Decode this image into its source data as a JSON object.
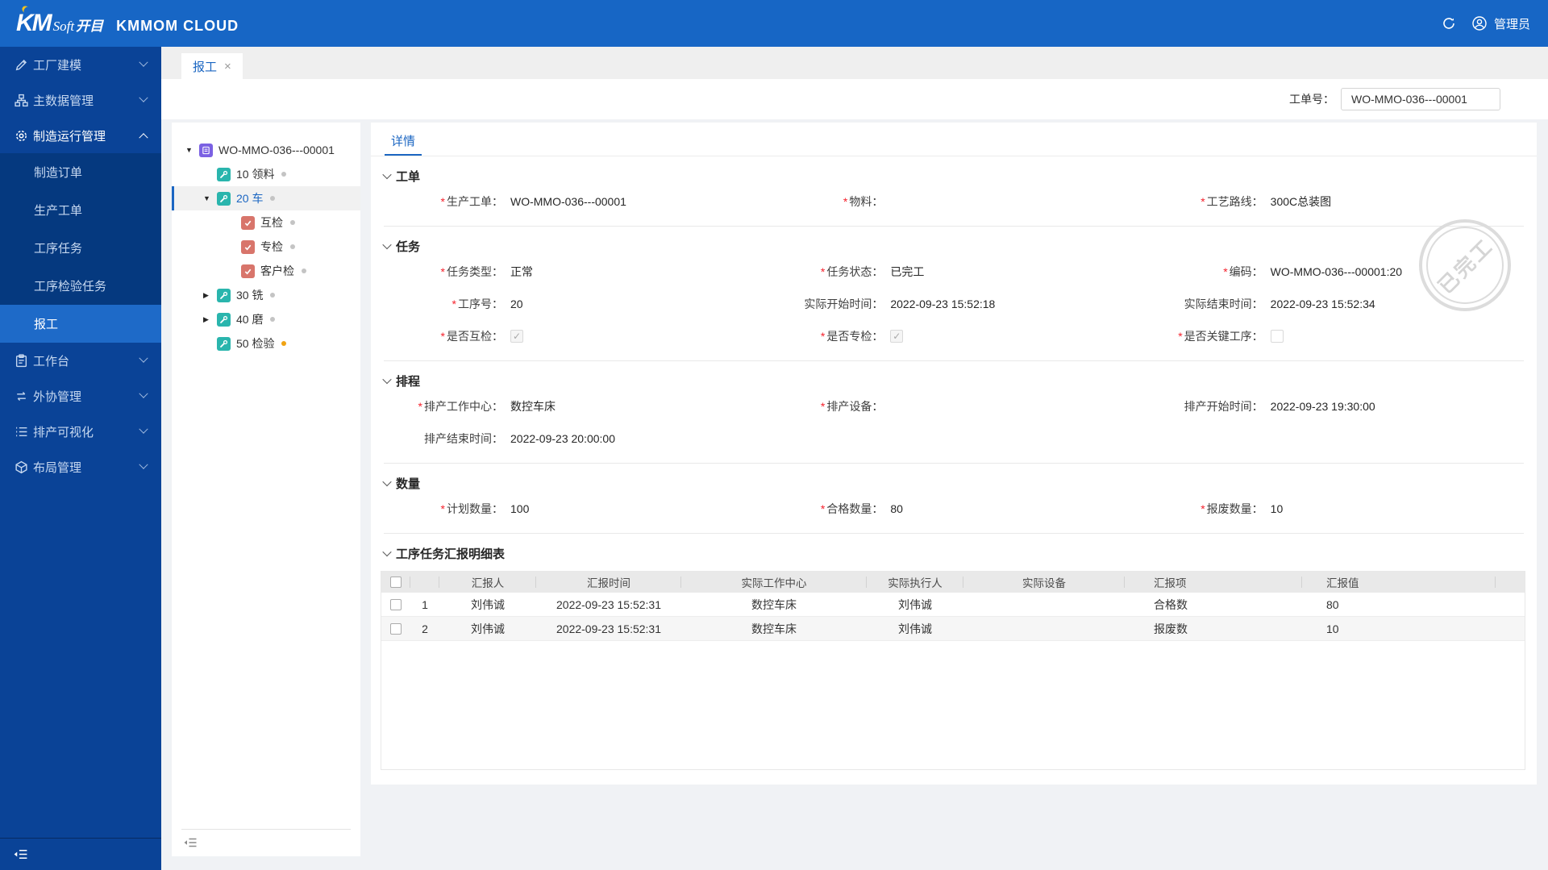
{
  "icons": {
    "asterisk": "*",
    "close": "×",
    "check": "✓",
    "tri_down": "▼",
    "tri_right": "▶"
  },
  "topbar": {
    "logo_km": "KM",
    "logo_soft": "Soft",
    "logo_cn": "开目",
    "product": "KMMOM CLOUD",
    "user": "管理员"
  },
  "sidebar": {
    "items": [
      {
        "label": "工厂建模"
      },
      {
        "label": "主数据管理"
      },
      {
        "label": "制造运行管理"
      },
      {
        "label": "制造订单"
      },
      {
        "label": "生产工单"
      },
      {
        "label": "工序任务"
      },
      {
        "label": "工序检验任务"
      },
      {
        "label": "报工"
      },
      {
        "label": "工作台"
      },
      {
        "label": "外协管理"
      },
      {
        "label": "排产可视化"
      },
      {
        "label": "布局管理"
      }
    ]
  },
  "tabs": {
    "active": "报工"
  },
  "toolbar": {
    "order_no_label": "工单号：",
    "order_no_value": "WO-MMO-036---00001"
  },
  "tree": {
    "nodes": [
      {
        "label": "WO-MMO-036---00001"
      },
      {
        "label": "10 领料"
      },
      {
        "label": "20 车",
        "selected": true
      },
      {
        "label": "互检"
      },
      {
        "label": "专检"
      },
      {
        "label": "客户检"
      },
      {
        "label": "30 铣"
      },
      {
        "label": "40 磨"
      },
      {
        "label": "50 检验",
        "dot_yellow": true
      }
    ]
  },
  "detail": {
    "tab": "详情",
    "stamp": "已完工",
    "sections": {
      "order": {
        "title": "工单",
        "fields": [
          {
            "label": "生产工单：",
            "required": true,
            "value": "WO-MMO-036---00001"
          },
          {
            "label": "物料：",
            "required": true,
            "value": ""
          },
          {
            "label": "工艺路线：",
            "required": true,
            "value": "300C总装图"
          }
        ]
      },
      "task": {
        "title": "任务",
        "fields": [
          {
            "label": "任务类型：",
            "required": true,
            "value": "正常"
          },
          {
            "label": "任务状态：",
            "required": true,
            "value": "已完工"
          },
          {
            "label": "编码：",
            "required": true,
            "value": "WO-MMO-036---00001:20"
          },
          {
            "label": "工序号：",
            "required": true,
            "value": "20"
          },
          {
            "label": "实际开始时间：",
            "required": false,
            "value": "2022-09-23 15:52:18"
          },
          {
            "label": "实际结束时间：",
            "required": false,
            "value": "2022-09-23 15:52:34"
          },
          {
            "label": "是否互检：",
            "required": true,
            "checked": true
          },
          {
            "label": "是否专检：",
            "required": true,
            "checked": true
          },
          {
            "label": "是否关键工序：",
            "required": true,
            "checked": false
          }
        ]
      },
      "schedule": {
        "title": "排程",
        "fields": [
          {
            "label": "排产工作中心：",
            "required": true,
            "value": "数控车床"
          },
          {
            "label": "排产设备：",
            "required": true,
            "value": ""
          },
          {
            "label": "排产开始时间：",
            "required": false,
            "value": "2022-09-23 19:30:00"
          },
          {
            "label": "排产结束时间：",
            "required": false,
            "value": "2022-09-23 20:00:00"
          }
        ]
      },
      "quantity": {
        "title": "数量",
        "fields": [
          {
            "label": "计划数量：",
            "required": true,
            "value": "100"
          },
          {
            "label": "合格数量：",
            "required": true,
            "value": "80"
          },
          {
            "label": "报废数量：",
            "required": true,
            "value": "10"
          }
        ]
      },
      "report": {
        "title": "工序任务汇报明细表"
      }
    },
    "table": {
      "headers": [
        "汇报人",
        "汇报时间",
        "实际工作中心",
        "实际执行人",
        "实际设备",
        "汇报项",
        "汇报值"
      ],
      "rows": [
        {
          "num": "1",
          "reporter": "刘伟诚",
          "time": "2022-09-23 15:52:31",
          "work_center": "数控车床",
          "executor": "刘伟诚",
          "equipment": "",
          "item": "合格数",
          "value": "80"
        },
        {
          "num": "2",
          "reporter": "刘伟诚",
          "time": "2022-09-23 15:52:31",
          "work_center": "数控车床",
          "executor": "刘伟诚",
          "equipment": "",
          "item": "报废数",
          "value": "10"
        }
      ]
    }
  }
}
